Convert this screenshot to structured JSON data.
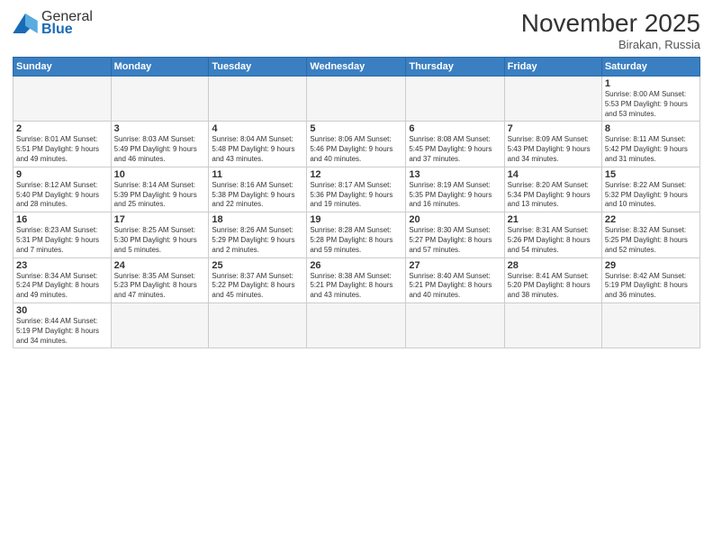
{
  "header": {
    "logo_text_general": "General",
    "logo_text_blue": "Blue",
    "month_year": "November 2025",
    "location": "Birakan, Russia"
  },
  "weekdays": [
    "Sunday",
    "Monday",
    "Tuesday",
    "Wednesday",
    "Thursday",
    "Friday",
    "Saturday"
  ],
  "weeks": [
    [
      {
        "day": "",
        "info": ""
      },
      {
        "day": "",
        "info": ""
      },
      {
        "day": "",
        "info": ""
      },
      {
        "day": "",
        "info": ""
      },
      {
        "day": "",
        "info": ""
      },
      {
        "day": "",
        "info": ""
      },
      {
        "day": "1",
        "info": "Sunrise: 8:00 AM\nSunset: 5:53 PM\nDaylight: 9 hours\nand 53 minutes."
      }
    ],
    [
      {
        "day": "2",
        "info": "Sunrise: 8:01 AM\nSunset: 5:51 PM\nDaylight: 9 hours\nand 49 minutes."
      },
      {
        "day": "3",
        "info": "Sunrise: 8:03 AM\nSunset: 5:49 PM\nDaylight: 9 hours\nand 46 minutes."
      },
      {
        "day": "4",
        "info": "Sunrise: 8:04 AM\nSunset: 5:48 PM\nDaylight: 9 hours\nand 43 minutes."
      },
      {
        "day": "5",
        "info": "Sunrise: 8:06 AM\nSunset: 5:46 PM\nDaylight: 9 hours\nand 40 minutes."
      },
      {
        "day": "6",
        "info": "Sunrise: 8:08 AM\nSunset: 5:45 PM\nDaylight: 9 hours\nand 37 minutes."
      },
      {
        "day": "7",
        "info": "Sunrise: 8:09 AM\nSunset: 5:43 PM\nDaylight: 9 hours\nand 34 minutes."
      },
      {
        "day": "8",
        "info": "Sunrise: 8:11 AM\nSunset: 5:42 PM\nDaylight: 9 hours\nand 31 minutes."
      }
    ],
    [
      {
        "day": "9",
        "info": "Sunrise: 8:12 AM\nSunset: 5:40 PM\nDaylight: 9 hours\nand 28 minutes."
      },
      {
        "day": "10",
        "info": "Sunrise: 8:14 AM\nSunset: 5:39 PM\nDaylight: 9 hours\nand 25 minutes."
      },
      {
        "day": "11",
        "info": "Sunrise: 8:16 AM\nSunset: 5:38 PM\nDaylight: 9 hours\nand 22 minutes."
      },
      {
        "day": "12",
        "info": "Sunrise: 8:17 AM\nSunset: 5:36 PM\nDaylight: 9 hours\nand 19 minutes."
      },
      {
        "day": "13",
        "info": "Sunrise: 8:19 AM\nSunset: 5:35 PM\nDaylight: 9 hours\nand 16 minutes."
      },
      {
        "day": "14",
        "info": "Sunrise: 8:20 AM\nSunset: 5:34 PM\nDaylight: 9 hours\nand 13 minutes."
      },
      {
        "day": "15",
        "info": "Sunrise: 8:22 AM\nSunset: 5:32 PM\nDaylight: 9 hours\nand 10 minutes."
      }
    ],
    [
      {
        "day": "16",
        "info": "Sunrise: 8:23 AM\nSunset: 5:31 PM\nDaylight: 9 hours\nand 7 minutes."
      },
      {
        "day": "17",
        "info": "Sunrise: 8:25 AM\nSunset: 5:30 PM\nDaylight: 9 hours\nand 5 minutes."
      },
      {
        "day": "18",
        "info": "Sunrise: 8:26 AM\nSunset: 5:29 PM\nDaylight: 9 hours\nand 2 minutes."
      },
      {
        "day": "19",
        "info": "Sunrise: 8:28 AM\nSunset: 5:28 PM\nDaylight: 8 hours\nand 59 minutes."
      },
      {
        "day": "20",
        "info": "Sunrise: 8:30 AM\nSunset: 5:27 PM\nDaylight: 8 hours\nand 57 minutes."
      },
      {
        "day": "21",
        "info": "Sunrise: 8:31 AM\nSunset: 5:26 PM\nDaylight: 8 hours\nand 54 minutes."
      },
      {
        "day": "22",
        "info": "Sunrise: 8:32 AM\nSunset: 5:25 PM\nDaylight: 8 hours\nand 52 minutes."
      }
    ],
    [
      {
        "day": "23",
        "info": "Sunrise: 8:34 AM\nSunset: 5:24 PM\nDaylight: 8 hours\nand 49 minutes."
      },
      {
        "day": "24",
        "info": "Sunrise: 8:35 AM\nSunset: 5:23 PM\nDaylight: 8 hours\nand 47 minutes."
      },
      {
        "day": "25",
        "info": "Sunrise: 8:37 AM\nSunset: 5:22 PM\nDaylight: 8 hours\nand 45 minutes."
      },
      {
        "day": "26",
        "info": "Sunrise: 8:38 AM\nSunset: 5:21 PM\nDaylight: 8 hours\nand 43 minutes."
      },
      {
        "day": "27",
        "info": "Sunrise: 8:40 AM\nSunset: 5:21 PM\nDaylight: 8 hours\nand 40 minutes."
      },
      {
        "day": "28",
        "info": "Sunrise: 8:41 AM\nSunset: 5:20 PM\nDaylight: 8 hours\nand 38 minutes."
      },
      {
        "day": "29",
        "info": "Sunrise: 8:42 AM\nSunset: 5:19 PM\nDaylight: 8 hours\nand 36 minutes."
      }
    ],
    [
      {
        "day": "30",
        "info": "Sunrise: 8:44 AM\nSunset: 5:19 PM\nDaylight: 8 hours\nand 34 minutes."
      },
      {
        "day": "",
        "info": ""
      },
      {
        "day": "",
        "info": ""
      },
      {
        "day": "",
        "info": ""
      },
      {
        "day": "",
        "info": ""
      },
      {
        "day": "",
        "info": ""
      },
      {
        "day": "",
        "info": ""
      }
    ]
  ]
}
